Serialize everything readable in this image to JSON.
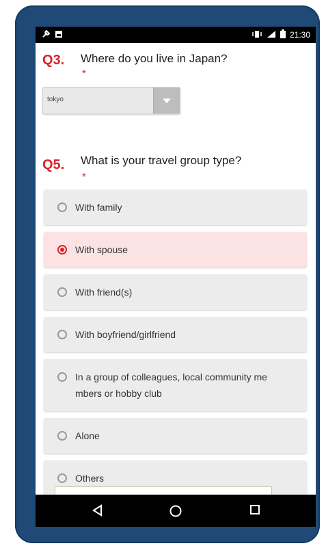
{
  "status_bar": {
    "time": "21:30"
  },
  "q3": {
    "number": "Q3.",
    "text": "Where do you live in Japan?",
    "required": "*",
    "select_value": "tokyo"
  },
  "q5": {
    "number": "Q5.",
    "text": "What is your travel group type?",
    "required": "*",
    "options": [
      {
        "label": "With family",
        "selected": false
      },
      {
        "label": "With spouse",
        "selected": true
      },
      {
        "label": "With friend(s)",
        "selected": false
      },
      {
        "label": "With boyfriend/girlfriend",
        "selected": false
      },
      {
        "label_line1": "In a group of colleagues, local community me",
        "label_line2": "mbers or hobby club",
        "selected": false
      },
      {
        "label": "Alone",
        "selected": false
      },
      {
        "label": "Others",
        "selected": false
      }
    ]
  },
  "colors": {
    "accent": "#d8232a",
    "frame": "#1f4a78",
    "selected_bg": "#fbe3e3"
  },
  "icons": [
    "wrench-icon",
    "image-icon",
    "vibrate-icon",
    "signal-icon",
    "battery-icon",
    "back-icon",
    "home-icon",
    "recents-icon"
  ]
}
